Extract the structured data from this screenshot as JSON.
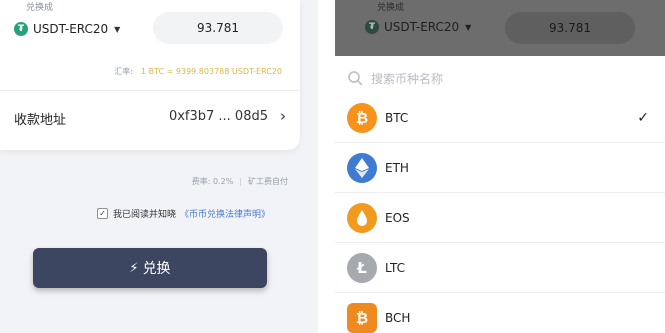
{
  "left": {
    "exchange_to_label": "兑换成",
    "selected_coin": "USDT-ERC20",
    "amount": "93.781",
    "rate_label": "汇率:",
    "rate_value": "1 BTC = 9399.803788 USDT-ERC20",
    "address_label": "收款地址",
    "address_value": "0xf3b7 ... 08d5",
    "fee_rate": "费率: 0.2%",
    "fee_note": "矿工费自付",
    "agree_text": "我已阅读并知晓",
    "agree_link": "《币币兑换法律声明》",
    "exchange_button": "兑换"
  },
  "right": {
    "exchange_to_label": "兑换成",
    "selected_coin": "USDT-ERC20",
    "amount": "93.781",
    "search_placeholder": "搜索币种名称",
    "coins": [
      {
        "symbol": "BTC",
        "color": "#f7931a",
        "icon": "bitcoin-icon",
        "selected": true
      },
      {
        "symbol": "ETH",
        "color": "#3f7bd0",
        "icon": "ethereum-icon",
        "selected": false
      },
      {
        "symbol": "EOS",
        "color": "#f29a1e",
        "icon": "eos-icon",
        "selected": false
      },
      {
        "symbol": "LTC",
        "color": "#a6a9ad",
        "icon": "litecoin-icon",
        "selected": false
      },
      {
        "symbol": "BCH",
        "color": "#ef8a1e",
        "icon": "bitcoin-cash-icon",
        "selected": false
      }
    ]
  },
  "colors": {
    "accent_gold": "#d9b84a",
    "link_blue": "#4a7bd6",
    "button_dark": "#3d4660",
    "usdt_green": "#26a17b"
  }
}
